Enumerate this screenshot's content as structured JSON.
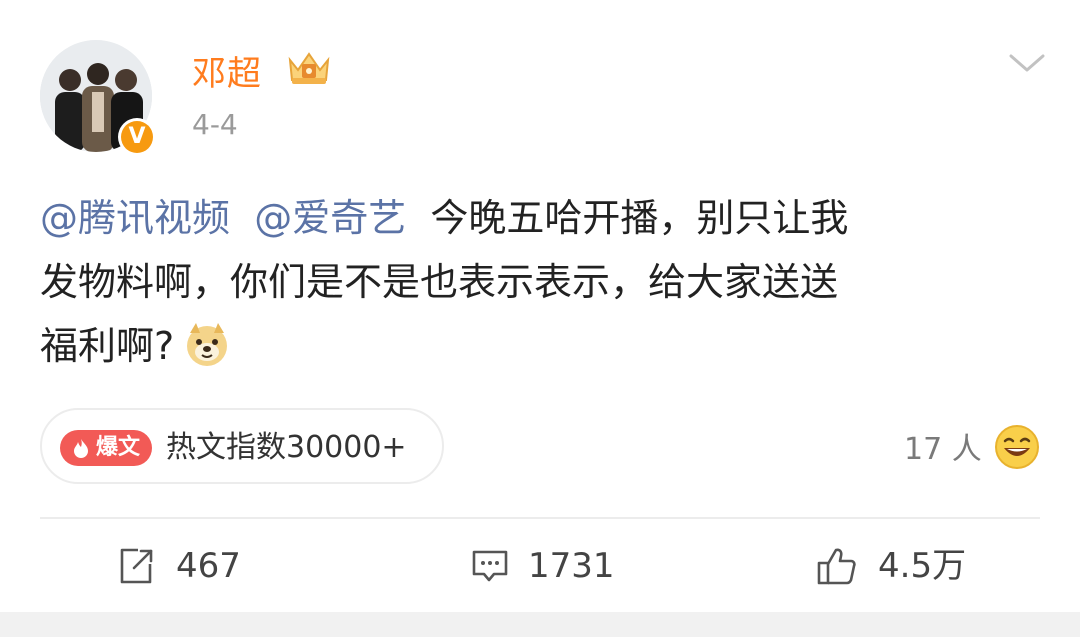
{
  "post": {
    "username": "邓超",
    "date": "4-4",
    "mentions": [
      "@腾讯视频",
      "@爱奇艺"
    ],
    "text_part1": "今晚五哈开播，别只让我",
    "text_part2": "发物料啊，你们是不是也表示表示，给大家送送",
    "text_part3": "福利啊?",
    "emoji": "doge-icon",
    "verified_badge": "V"
  },
  "hot": {
    "tag_label": "爆文",
    "label": "热文指数30000+",
    "tag_color": "#f25a56"
  },
  "reactions": {
    "likers_text": "17 人",
    "emoji": "laughing-face-icon"
  },
  "actions": {
    "repost_count": "467",
    "comment_count": "1731",
    "like_count": "4.5万"
  },
  "colors": {
    "username": "#ff7c1e",
    "mention": "#5b73a6",
    "secondary_text": "#9a9a9a"
  }
}
